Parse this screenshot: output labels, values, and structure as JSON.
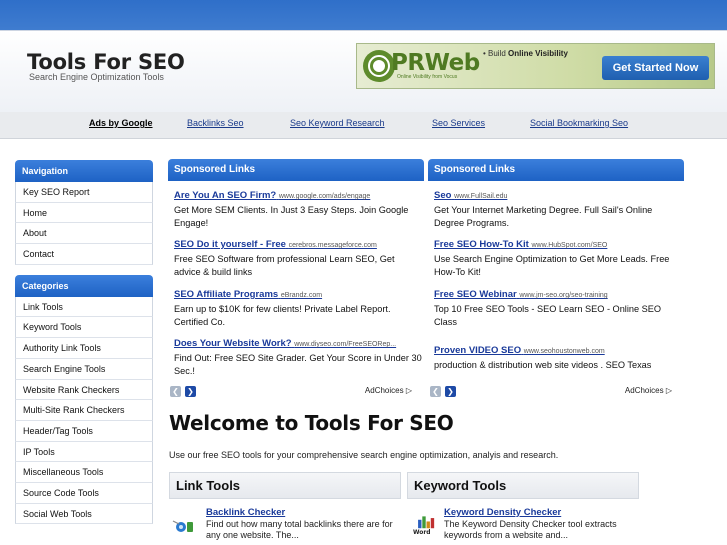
{
  "header": {
    "title": "Tools For SEO",
    "tagline": "Search Engine Optimization Tools"
  },
  "banner": {
    "brand": "PRWeb",
    "sub": "Online Visibility from Vocus",
    "build_prefix": "• Build ",
    "build_strong": "Online Visibility",
    "cta": "Get Started Now",
    "brand_color": "#4f7a22"
  },
  "adlinks": {
    "title": "Ads by Google",
    "links": [
      "Backlinks Seo",
      "Seo Keyword Research",
      "Seo Services",
      "Social Bookmarking Seo"
    ]
  },
  "sidebar": {
    "nav_head": "Navigation",
    "nav_items": [
      "Key SEO Report",
      "Home",
      "About",
      "Contact"
    ],
    "cat_head": "Categories",
    "cat_items": [
      "Link Tools",
      "Keyword Tools",
      "Authority Link Tools",
      "Search Engine Tools",
      "Website Rank Checkers",
      "Multi-Site Rank Checkers",
      "Header/Tag Tools",
      "IP Tools",
      "Miscellaneous Tools",
      "Source Code Tools",
      "Social Web Tools"
    ]
  },
  "sponsored": [
    {
      "head": "Sponsored Links",
      "ads": [
        {
          "title": "Are You An SEO Firm?",
          "url": "www.google.com/ads/engage",
          "desc": "Get More SEM Clients. In Just 3 Easy Steps. Join Google Engage!"
        },
        {
          "title": "SEO Do it yourself - Free",
          "url": "cerebros.messageforce.com",
          "desc": "Free SEO Software from professional Learn SEO, Get advice & build links"
        },
        {
          "title": "SEO Affiliate Programs",
          "url": "eBrandz.com",
          "desc": "Earn up to $10K for few clients! Private Label Report. Certified Co."
        },
        {
          "title": "Does Your Website Work?",
          "url": "www.diyseo.com/FreeSEORep...",
          "desc": "Find Out: Free SEO Site Grader. Get Your Score in Under 30 Sec.!"
        }
      ],
      "adchoices": "AdChoices"
    },
    {
      "head": "Sponsored Links",
      "ads": [
        {
          "title": "Seo",
          "url": "www.FullSail.edu",
          "desc": "Get Your Internet Marketing Degree. Full Sail's Online Degree Programs."
        },
        {
          "title": "Free SEO How-To Kit",
          "url": "www.HubSpot.com/SEO",
          "desc": "Use Search Engine Optimization to Get More Leads. Free How-To Kit!"
        },
        {
          "title": "Free SEO Webinar",
          "url": "www.jm-seo.org/seo-training",
          "desc": "Top 10 Free SEO Tools - SEO Learn SEO - Online SEO Class"
        },
        {
          "title": "Proven VIDEO SEO",
          "url": "www.seohoustonweb.com",
          "desc": "production & distribution web site videos . SEO Texas"
        }
      ],
      "adchoices": "AdChoices"
    }
  ],
  "welcome": {
    "title": "Welcome to Tools For SEO",
    "text": "Use our free SEO tools for your comprehensive search engine optimization, analyis and research."
  },
  "tools": [
    {
      "head": "Link Tools",
      "link": "Backlink Checker",
      "desc": "Find out how many total backlinks there are for any one website. The..."
    },
    {
      "head": "Keyword Tools",
      "link": "Keyword Density Checker",
      "desc": "The Keyword Density Checker tool extracts keywords from a website and..."
    }
  ],
  "colors": {
    "header_blue": "#2f6fc9",
    "box_blue": "#1e62c4",
    "link_blue": "#1a3a9a"
  }
}
